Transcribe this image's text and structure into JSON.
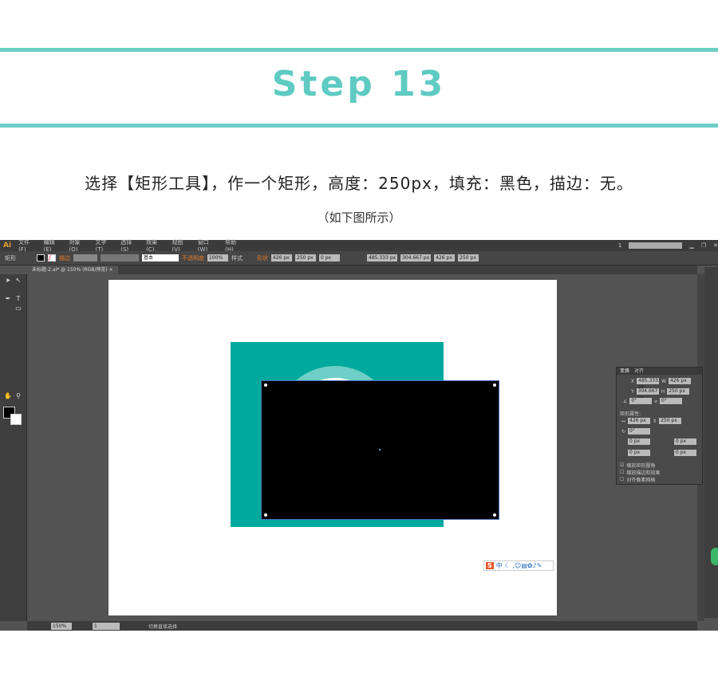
{
  "header": {
    "step": "Step 13",
    "description": "选择【矩形工具】，作一个矩形，高度：250px，填充：黑色，描边：无。",
    "note": "（如下图所示）"
  },
  "app": {
    "logo": "Ai",
    "menu": [
      "文件(F)",
      "编辑(E)",
      "对象(O)",
      "文字(T)",
      "选择(S)",
      "效果(C)",
      "视图(V)",
      "窗口(W)",
      "帮助(H)"
    ],
    "workspace": "1",
    "control": {
      "object_type": "矩形",
      "stroke_label": "描边",
      "stroke_style": "基本",
      "opacity_label": "不透明度",
      "opacity": "100%",
      "style_label": "样式",
      "shape_label": "形状",
      "width": "426 px",
      "height": "250 px",
      "radius": "0 px",
      "x": "485.333 px",
      "y": "304.667 px",
      "w": "426 px",
      "h": "250 px"
    },
    "document_tab": {
      "title": "未标题-2.ai* @ 150% (RGB/预览)",
      "close": "×"
    },
    "status": {
      "zoom": "150%",
      "artboard": "1",
      "tool_name": "切换直接选择"
    },
    "ime": {
      "badge": "S",
      "label": "中"
    },
    "transform_panel": {
      "tabs": [
        "变换",
        "对齐"
      ],
      "x": "485.333 px",
      "y": "304.667 px",
      "w": "426 px",
      "h": "250 px",
      "rotate": "0°",
      "shear": "0°",
      "rect_props_label": "矩形属性:",
      "rect_w": "426 px",
      "rect_h": "250 px",
      "rect_rotate": "0°",
      "corners": [
        "0 px",
        "0 px",
        "0 px",
        "0 px"
      ],
      "checkboxes": [
        {
          "label": "缩放矩形圆角",
          "checked": true
        },
        {
          "label": "缩放描边和效果",
          "checked": false
        },
        {
          "label": "对齐像素网格",
          "checked": false
        }
      ]
    }
  },
  "colors": {
    "accent": "#6ccfc6",
    "teal": "#00a99d",
    "arc": "#6dcfc7"
  }
}
